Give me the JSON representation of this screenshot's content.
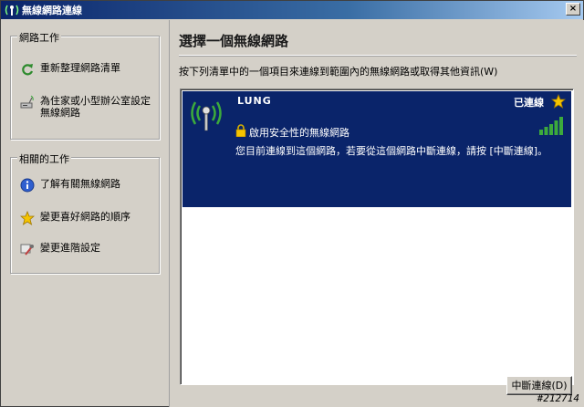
{
  "window": {
    "title": "無線網路連線",
    "close_glyph": "×"
  },
  "sidebar": {
    "network_tasks": {
      "title": "網路工作",
      "items": [
        {
          "label": "重新整理網路清單",
          "icon": "refresh-icon"
        },
        {
          "label": "為住家或小型辦公室設定無線網路",
          "icon": "wireless-setup-icon"
        }
      ]
    },
    "related_tasks": {
      "title": "相關的工作",
      "items": [
        {
          "label": "了解有關無線網路",
          "icon": "info-icon"
        },
        {
          "label": "變更喜好網路的順序",
          "icon": "star-icon"
        },
        {
          "label": "變更進階設定",
          "icon": "settings-icon"
        }
      ]
    }
  },
  "main": {
    "title": "選擇一個無線網路",
    "instruction": "按下列清單中的一個項目來連線到範圍內的無線網路或取得其他資訊(W)",
    "network": {
      "name": "LUNG",
      "status": "已連線",
      "security": "啟用安全性的無線網路",
      "description": "您目前連線到這個網路，若要從這個網路中斷連線，請按 [中斷連線]。",
      "signal_bars": 5
    },
    "disconnect_label": "中斷連線(D)"
  },
  "watermark": "#212714",
  "colors": {
    "selection": "#0a246a",
    "window_bg": "#d4d0c8",
    "star": "#f5c400",
    "signal": "#3caa3c"
  }
}
